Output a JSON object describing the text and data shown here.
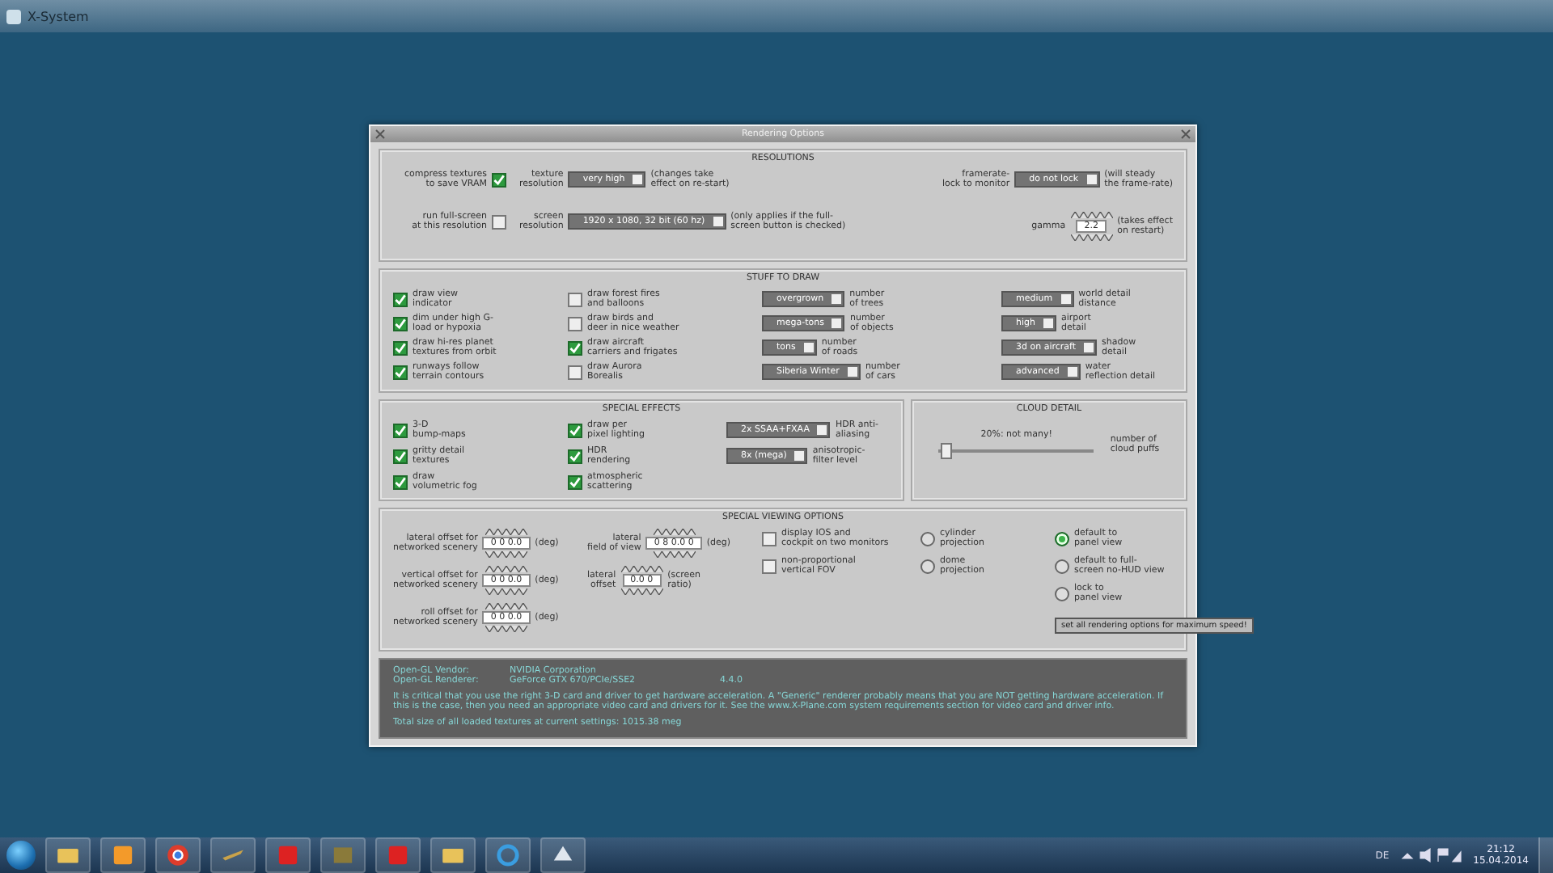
{
  "window": {
    "title": "X-System"
  },
  "dialog": {
    "title": "Rendering Options"
  },
  "panels": [
    {
      "title": "RESOLUTIONS",
      "columns": [
        [
          {
            "kind": "checkbox",
            "label": "compress textures\nto save VRAM",
            "checked": true
          },
          {
            "kind": "checkbox",
            "label": "run full-screen\nat this resolution",
            "checked": false
          }
        ],
        [
          {
            "kind": "dropdown",
            "label": "texture\nresolution",
            "value": "very high",
            "note": "(changes take\neffect on re-start)"
          },
          {
            "kind": "dropdown",
            "label": "screen\nresolution",
            "value": "1920 x 1080, 32 bit (60 hz)",
            "note": "(only applies if the full-\nscreen button is checked)"
          }
        ],
        [
          {
            "kind": "dropdown",
            "label": "framerate-\nlock to monitor",
            "value": "do not lock",
            "note": "(will steady\nthe frame-rate)"
          },
          {
            "kind": "spinner",
            "label": "gamma",
            "value": "2.2",
            "note": "(takes effect\non restart)"
          }
        ]
      ]
    },
    {
      "title": "STUFF TO DRAW",
      "columns": [
        [
          {
            "kind": "checkbox",
            "label": "draw view\nindicator",
            "checked": true
          },
          {
            "kind": "checkbox",
            "label": "dim under high G-\nload or hypoxia",
            "checked": true
          },
          {
            "kind": "checkbox",
            "label": "draw hi-res planet\ntextures from orbit",
            "checked": true
          },
          {
            "kind": "checkbox",
            "label": "runways follow\nterrain contours",
            "checked": true
          }
        ],
        [
          {
            "kind": "checkbox",
            "label": "draw forest fires\nand balloons",
            "checked": false
          },
          {
            "kind": "checkbox",
            "label": "draw birds and\ndeer in nice weather",
            "checked": false
          },
          {
            "kind": "checkbox",
            "label": "draw aircraft\ncarriers and frigates",
            "checked": true
          },
          {
            "kind": "checkbox",
            "label": "draw Aurora\nBorealis",
            "checked": false
          }
        ],
        [
          {
            "kind": "dropdown",
            "value": "overgrown",
            "label": "number\nof trees"
          },
          {
            "kind": "dropdown",
            "value": "mega-tons",
            "label": "number\nof objects"
          },
          {
            "kind": "dropdown",
            "value": "tons",
            "label": "number\nof roads"
          },
          {
            "kind": "dropdown",
            "value": "Siberia Winter",
            "label": "number\nof cars"
          }
        ],
        [
          {
            "kind": "dropdown",
            "value": "medium",
            "label": "world detail\ndistance"
          },
          {
            "kind": "dropdown",
            "value": "high",
            "label": "airport\ndetail"
          },
          {
            "kind": "dropdown",
            "value": "3d on aircraft",
            "label": "shadow\ndetail"
          },
          {
            "kind": "dropdown",
            "value": "advanced",
            "label": "water\nreflection detail"
          }
        ]
      ]
    },
    {
      "title": "SPECIAL EFFECTS",
      "columns": [
        [
          {
            "kind": "checkbox",
            "label": "3-D\nbump-maps",
            "checked": true
          },
          {
            "kind": "checkbox",
            "label": "gritty detail\ntextures",
            "checked": true
          },
          {
            "kind": "checkbox",
            "label": "draw\nvolumetric fog",
            "checked": true
          }
        ],
        [
          {
            "kind": "checkbox",
            "label": "draw per\npixel lighting",
            "checked": true
          },
          {
            "kind": "checkbox",
            "label": "HDR\nrendering",
            "checked": true
          },
          {
            "kind": "checkbox",
            "label": "atmospheric\nscattering",
            "checked": true
          }
        ],
        [
          {
            "kind": "dropdown",
            "value": "2x SSAA+FXAA",
            "label": "HDR anti-\naliasing"
          },
          {
            "kind": "dropdown",
            "value": "8x (mega)",
            "label": "anisotropic-\nfilter level"
          }
        ]
      ]
    },
    {
      "title": "CLOUD DETAIL",
      "columns": [
        [
          {
            "kind": "slider",
            "reading": "20%: not many!",
            "level": 0.05,
            "label": "number of\ncloud puffs"
          }
        ]
      ]
    },
    {
      "title": "SPECIAL VIEWING OPTIONS",
      "columns": [
        [
          {
            "kind": "spinner",
            "label": "lateral offset for\nnetworked scenery",
            "value": "0 0 0.0",
            "note": "(deg)"
          },
          {
            "kind": "spinner",
            "label": "vertical offset for\nnetworked scenery",
            "value": "0 0 0.0",
            "note": "(deg)"
          },
          {
            "kind": "spinner",
            "label": "roll offset for\nnetworked scenery",
            "value": "0 0 0.0",
            "note": "(deg)"
          }
        ],
        [
          {
            "kind": "spinner",
            "label": "lateral\nfield of view",
            "value": "0 8 0.0 0",
            "note": "(deg)"
          },
          {
            "kind": "spinner",
            "label": "lateral\noffset",
            "value": "0.0 0",
            "note": "(screen\nratio)"
          }
        ],
        [
          {
            "kind": "checkbox",
            "label": "display IOS and\ncockpit on two monitors",
            "checked": false
          },
          {
            "kind": "checkbox",
            "label": "non-proportional\nvertical FOV",
            "checked": false
          }
        ],
        [
          {
            "kind": "radio",
            "label": "cylinder\nprojection",
            "selected": false
          },
          {
            "kind": "radio",
            "label": "dome\nprojection",
            "selected": false
          }
        ],
        [
          {
            "kind": "radio",
            "label": "default to\npanel view",
            "selected": true
          },
          {
            "kind": "radio",
            "label": "default to full-\nscreen no-HUD view",
            "selected": false
          },
          {
            "kind": "radio",
            "label": "lock to\npanel view",
            "selected": false
          },
          {
            "kind": "button",
            "label": "set all rendering options for maximum speed!"
          }
        ]
      ]
    }
  ],
  "info": {
    "vendor_label": "Open-GL Vendor:",
    "vendor": "NVIDIA Corporation",
    "renderer_label": "Open-GL Renderer:",
    "renderer": "GeForce GTX 670/PCIe/SSE2",
    "version": "4.4.0",
    "message": "It is critical that you use the right 3-D card and driver to get hardware acceleration. A \"Generic\" renderer probably means that you are NOT getting hardware acceleration. If this is the case, then you need an appropriate video card and drivers for it. See the www.X-Plane.com system requirements section for video card and driver info.",
    "texture_size": "Total size of all loaded textures at current settings: 1015.38 meg"
  },
  "taskbar": {
    "language": "DE",
    "time": "21:12",
    "date": "15.04.2014"
  }
}
